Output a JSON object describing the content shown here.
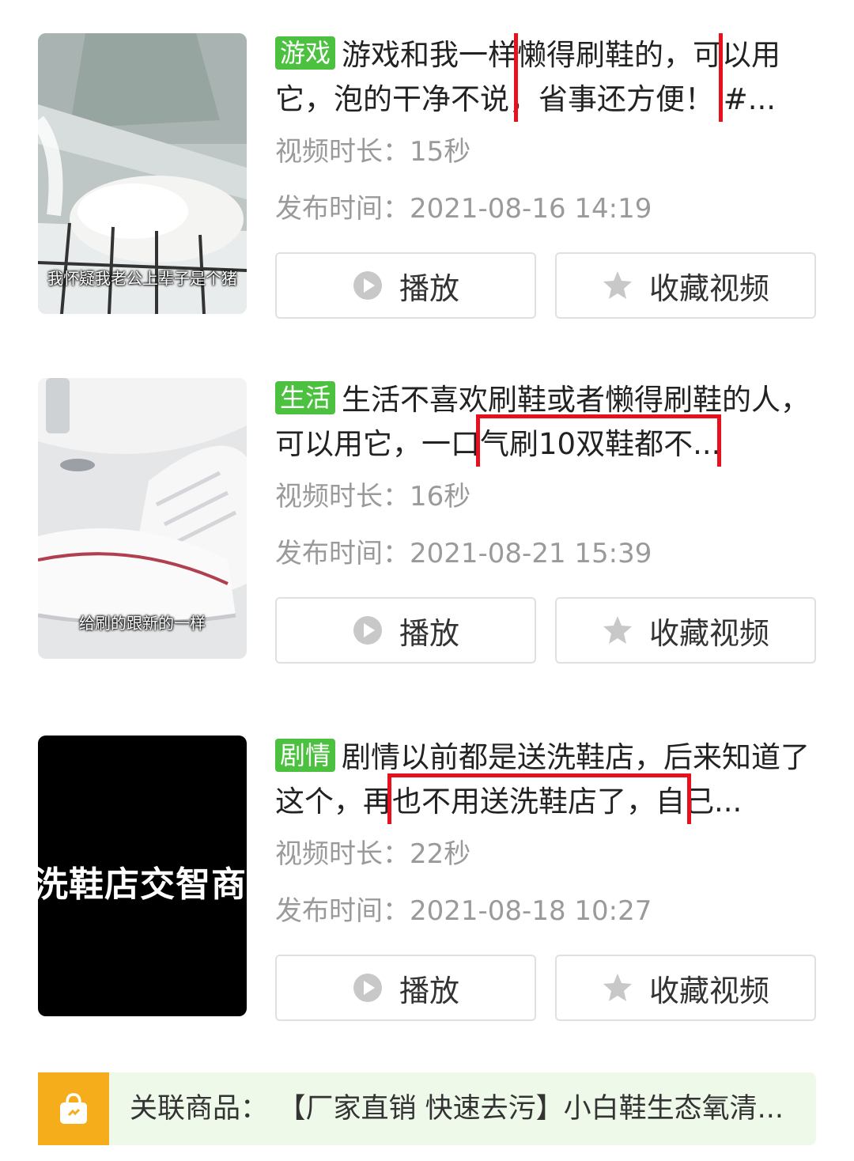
{
  "videos": [
    {
      "tag": "游戏",
      "title": "游戏和我一样懒得刷鞋的，可以用它，泡的干净不说，省事还方便！ #...",
      "thumb_caption": "我怀疑我老公上辈子是个猪",
      "duration": "视频时长：15秒",
      "publish_time": "发布时间：2021-08-16 14:19",
      "play_label": "播放",
      "fav_label": "收藏视频"
    },
    {
      "tag": "生活",
      "title": "生活不喜欢刷鞋或者懒得刷鞋的人，可以用它，一口气刷10双鞋都不...",
      "thumb_caption": "给刷的跟新的一样",
      "duration": "视频时长：16秒",
      "publish_time": "发布时间：2021-08-21 15:39",
      "play_label": "播放",
      "fav_label": "收藏视频"
    },
    {
      "tag": "剧情",
      "title": "剧情以前都是送洗鞋店，后来知道了这个，再也不用送洗鞋店了，自己...",
      "thumb_caption": "洗鞋店交智商",
      "duration": "视频时长：22秒",
      "publish_time": "发布时间：2021-08-18 10:27",
      "play_label": "播放",
      "fav_label": "收藏视频"
    }
  ],
  "product": {
    "label": "关联商品：",
    "name": "【厂家直销 快速去污】小白鞋生态氧清..."
  },
  "colors": {
    "tag_green": "#4cc13f",
    "highlight_red": "#e8101c",
    "meta_gray": "#9a9a9a",
    "product_orange": "#f6ad1c",
    "product_bg": "#eef9ea"
  },
  "icons": [
    "play-circle-icon",
    "star-icon",
    "shopping-bag-icon"
  ]
}
